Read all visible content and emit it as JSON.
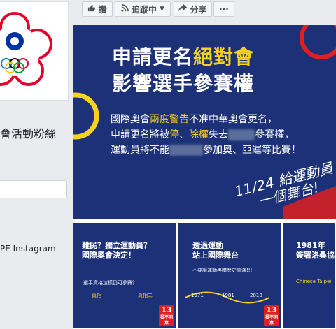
{
  "sidebar": {
    "page_name": "會活動粉絲",
    "instagram_link": "PE Instagram"
  },
  "actions": {
    "like_label": "讚",
    "follow_label": "追蹤中",
    "share_label": "分享",
    "more_label": "···"
  },
  "post": {
    "headline_1a": "申請更名",
    "headline_1b": "絕對會",
    "headline_2": "影響選手參賽權",
    "body_1a": "國際奧會",
    "body_1b": "兩度警告",
    "body_1c": "不准中華奧會更名，",
    "body_2a": "申請更名將被",
    "body_2b": "停",
    "body_2c": "、",
    "body_2d": "除權",
    "body_2e": "失去",
    "body_2f": "參賽權，",
    "body_3a": "運動員將不能",
    "body_3b": "參加奧、亞運等比賽！",
    "slogan_1": "11/24 給運動員",
    "slogan_2": "一個舞台!"
  },
  "thumbs": [
    {
      "title_1": "難民？獨立運動員？",
      "title_2": "國際奧會決定！",
      "sub": "選手資格這樣仍可參賽？",
      "opt_1": "真相一",
      "opt_2": "真相二",
      "badge": "13",
      "badge_sub": "投不同意"
    },
    {
      "title_1": "透過運動",
      "title_2": "站上國際舞台",
      "sub": "不要讓運動黑暗歷史重演!!!",
      "year_1": "1971",
      "year_2": "1981",
      "year_3": "2018",
      "badge": "13",
      "badge_sub": "投不同意"
    },
    {
      "title_1": "1981年",
      "title_2": "簽署洛桑協議",
      "sub": "Chinese Taipei"
    }
  ],
  "colors": {
    "banner_blue": "#1c3178",
    "accent_yellow": "#f7d21e",
    "badge_red": "#e02020",
    "fb_bg": "#e9ebee"
  }
}
